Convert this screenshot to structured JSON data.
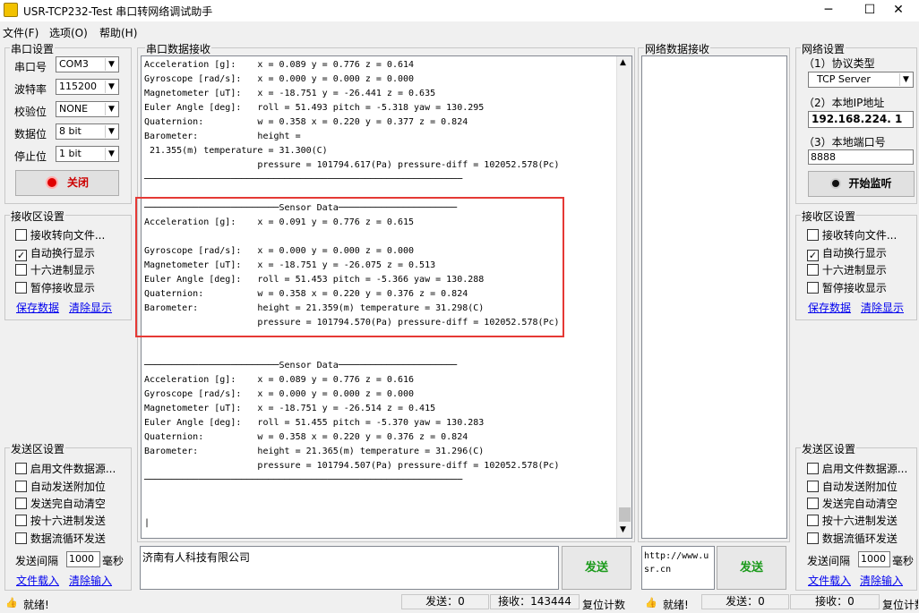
{
  "window": {
    "title": "USR-TCP232-Test 串口转网络调试助手",
    "min": "─",
    "max": "☐",
    "close": "✕"
  },
  "menu": [
    "文件(F)",
    "选项(O)",
    "帮助(H)"
  ],
  "serial": {
    "group": "串口设置",
    "port_label": "串口号",
    "port": "COM3",
    "baud_label": "波特率",
    "baud": "115200",
    "parity_label": "校验位",
    "parity": "NONE",
    "databits_label": "数据位",
    "databits": "8 bit",
    "stopbits_label": "停止位",
    "stopbits": "1 bit",
    "close_btn": "关闭"
  },
  "recv_left": {
    "group": "接收区设置",
    "opts": [
      "接收转向文件...",
      "自动换行显示",
      "十六进制显示",
      "暂停接收显示"
    ],
    "checked": [
      false,
      true,
      false,
      false
    ],
    "save": "保存数据",
    "clear": "清除显示"
  },
  "send_left": {
    "group": "发送区设置",
    "opts": [
      "启用文件数据源...",
      "自动发送附加位",
      "发送完自动清空",
      "按十六进制发送",
      "数据流循环发送"
    ],
    "interval_label": "发送间隔",
    "interval": "1000",
    "unit": "毫秒",
    "load": "文件载入",
    "clear": "清除输入"
  },
  "serial_recv": {
    "group": "串口数据接收",
    "lines": [
      "Acceleration [g]:    x = 0.089 y = 0.776 z = 0.614",
      "Gyroscope [rad/s]:   x = 0.000 y = 0.000 z = 0.000",
      "Magnetometer [uT]:   x = -18.751 y = -26.441 z = 0.635",
      "Euler Angle [deg]:   roll = 51.493 pitch = -5.318 yaw = 130.295",
      "Quaternion:          w = 0.358 x = 0.220 y = 0.377 z = 0.824",
      "Barometer:           height =",
      " 21.355(m) temperature = 31.300(C)",
      "                     pressure = 101794.617(Pa) pressure-diff = 102052.578(Pc)",
      "───────────────────────────────────────────────────────────",
      "",
      "─────────────────────────Sensor Data──────────────────────",
      "Acceleration [g]:    x = 0.091 y = 0.776 z = 0.615",
      "",
      "Gyroscope [rad/s]:   x = 0.000 y = 0.000 z = 0.000",
      "Magnetometer [uT]:   x = -18.751 y = -26.075 z = 0.513",
      "Euler Angle [deg]:   roll = 51.453 pitch = -5.366 yaw = 130.288",
      "Quaternion:          w = 0.358 x = 0.220 y = 0.376 z = 0.824",
      "Barometer:           height = 21.359(m) temperature = 31.298(C)",
      "                     pressure = 101794.570(Pa) pressure-diff = 102052.578(Pc)",
      "",
      "",
      "─────────────────────────Sensor Data──────────────────────",
      "Acceleration [g]:    x = 0.089 y = 0.776 z = 0.616",
      "Gyroscope [rad/s]:   x = 0.000 y = 0.000 z = 0.000",
      "Magnetometer [uT]:   x = -18.751 y = -26.514 z = 0.415",
      "Euler Angle [deg]:   roll = 51.455 pitch = -5.370 yaw = 130.283",
      "Quaternion:          w = 0.358 x = 0.220 y = 0.376 z = 0.824",
      "Barometer:           height = 21.365(m) temperature = 31.296(C)",
      "                     pressure = 101794.507(Pa) pressure-diff = 102052.578(Pc)",
      "───────────────────────────────────────────────────────────",
      "",
      "",
      "|"
    ]
  },
  "net_recv": {
    "group": "网络数据接收"
  },
  "net": {
    "group": "网络设置",
    "proto_label": "（1）协议类型",
    "proto": "TCP Server",
    "ip_label": "（2）本地IP地址",
    "ip": "192.168.224. 1",
    "port_label": "（3）本地端口号",
    "port": "8888",
    "listen_btn": "开始监听"
  },
  "recv_right": {
    "group": "接收区设置",
    "opts": [
      "接收转向文件...",
      "自动换行显示",
      "十六进制显示",
      "暂停接收显示"
    ],
    "checked": [
      false,
      true,
      false,
      false
    ],
    "save": "保存数据",
    "clear": "清除显示"
  },
  "send_right": {
    "group": "发送区设置",
    "opts": [
      "启用文件数据源...",
      "自动发送附加位",
      "发送完自动清空",
      "按十六进制发送",
      "数据流循环发送"
    ],
    "interval_label": "发送间隔",
    "interval": "1000",
    "unit": "毫秒",
    "load": "文件载入",
    "clear": "清除输入"
  },
  "send_serial": {
    "text": "济南有人科技有限公司",
    "btn": "发送"
  },
  "send_net": {
    "text": "http://www.usr.cn",
    "btn": "发送"
  },
  "status": {
    "ready": "就绪!",
    "send": "发送：0",
    "recv": "接收：143444",
    "reset": "复位计数",
    "ready2": "就绪!",
    "send2": "发送：0",
    "recv2": "接收：0",
    "reset2": "复位计数"
  },
  "colors": {
    "highlight": "#e53935",
    "send_green": "#1a9a1a"
  }
}
